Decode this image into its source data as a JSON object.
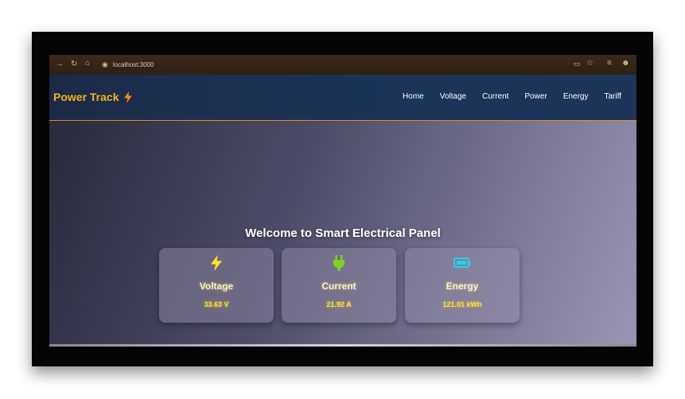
{
  "browser": {
    "url": "localhost:3000"
  },
  "brand": {
    "name": "Power Track",
    "accent_color": "#f5b418"
  },
  "nav": {
    "links": [
      "Home",
      "Voltage",
      "Current",
      "Power",
      "Energy",
      "Tariff"
    ]
  },
  "main": {
    "welcome": "Welcome to Smart Electrical Panel"
  },
  "cards": [
    {
      "title": "Voltage",
      "value": "33.63 V",
      "icon": "lightning-bolt-icon",
      "icon_color": "#ffe22e"
    },
    {
      "title": "Current",
      "value": "21.92 A",
      "icon": "plug-icon",
      "icon_color": "#7ed321"
    },
    {
      "title": "Energy",
      "value": "121.01 kWh",
      "icon": "battery-icon",
      "icon_color": "#22d3ee"
    }
  ]
}
